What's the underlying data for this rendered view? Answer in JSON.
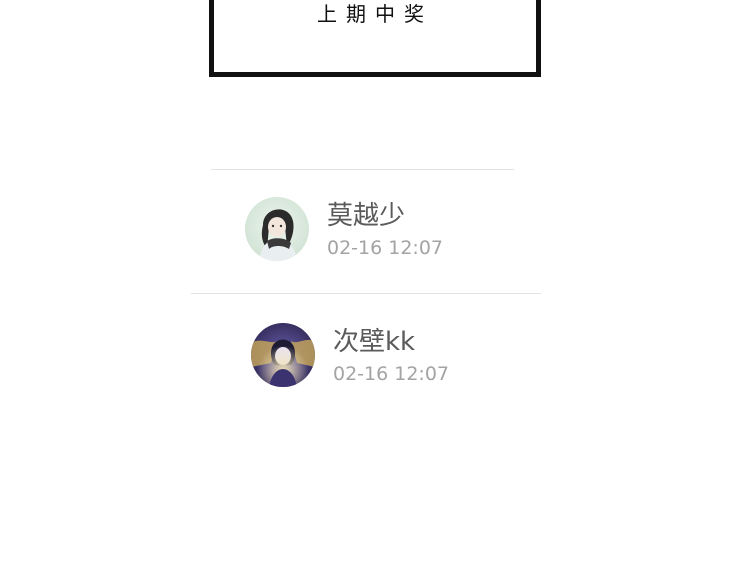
{
  "banner": {
    "title": "上期中奖"
  },
  "winners": [
    {
      "name": "莫越少",
      "time": "02-16 12:07",
      "avatar_icon": "anime-character-avatar-icon"
    },
    {
      "name": "次壁kk",
      "time": "02-16 12:07",
      "avatar_icon": "anime-character-avatar-icon"
    }
  ],
  "colors": {
    "frame": "#111111",
    "name_text": "#5a5a5a",
    "time_text": "#a3a3a3",
    "divider": "#e3e3e3"
  }
}
